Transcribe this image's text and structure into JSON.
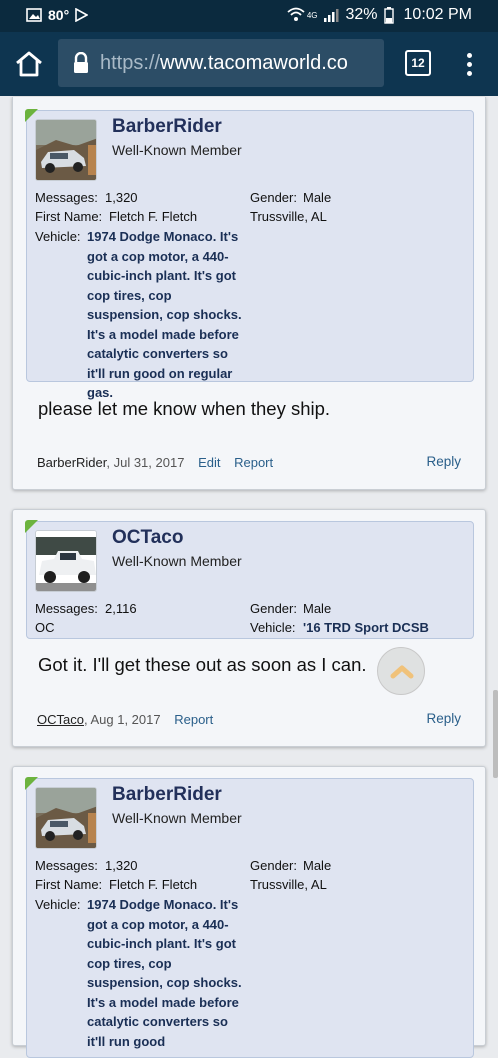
{
  "status_bar": {
    "temperature": "80°",
    "signal_label": "4G",
    "battery": "32%",
    "time": "10:02 PM"
  },
  "browser": {
    "url_protocol": "https://",
    "url_host": "www.tacomaworld.co",
    "tab_count": "12"
  },
  "posts": [
    {
      "author": "BarberRider",
      "title": "Well-Known Member",
      "messages_label": "Messages:",
      "messages": "1,320",
      "gender_label": "Gender:",
      "gender": "Male",
      "first_name_label": "First Name:",
      "first_name": "Fletch F. Fletch",
      "location": "Trussville, AL",
      "vehicle_label": "Vehicle:",
      "vehicle": "1974 Dodge Monaco. It's got a cop motor, a 440-cubic-inch plant. It's got cop tires, cop suspension, cop shocks. It's a model made before catalytic converters so it'll run good on regular gas.",
      "body": "please let me know when they ship.",
      "footer_author": "BarberRider",
      "date": ", Jul 31, 2017",
      "edit": "Edit",
      "report": "Report",
      "reply": "Reply"
    },
    {
      "author": "OCTaco",
      "title": "Well-Known Member",
      "messages_label": "Messages:",
      "messages": "2,116",
      "gender_label": "Gender:",
      "gender": "Male",
      "location": "OC",
      "vehicle_label": "Vehicle:",
      "vehicle": "'16 TRD Sport DCSB",
      "body": "Got it. I'll get these out as soon as I can.",
      "footer_author": "OCTaco",
      "date": ", Aug 1, 2017",
      "report": "Report",
      "reply": "Reply"
    },
    {
      "author": "BarberRider",
      "title": "Well-Known Member",
      "messages_label": "Messages:",
      "messages": "1,320",
      "gender_label": "Gender:",
      "gender": "Male",
      "first_name_label": "First Name:",
      "first_name": "Fletch F. Fletch",
      "location": "Trussville, AL",
      "vehicle_label": "Vehicle:",
      "vehicle": "1974 Dodge Monaco. It's got a cop motor, a 440-cubic-inch plant. It's got cop tires, cop suspension, cop shocks. It's a model made before catalytic converters so it'll run good"
    }
  ],
  "colors": {
    "status_bg": "#0b2a3e",
    "toolbar_bg": "#0e3550",
    "user_box": "#dfe4f1",
    "link": "#2a5f8a",
    "online": "#6cb33e"
  },
  "icons": [
    "image-icon",
    "play-store-icon",
    "wifi-icon",
    "signal-icon",
    "battery-icon",
    "home-icon",
    "lock-icon",
    "tabs-icon",
    "overflow-menu-icon",
    "chevron-up-icon"
  ]
}
